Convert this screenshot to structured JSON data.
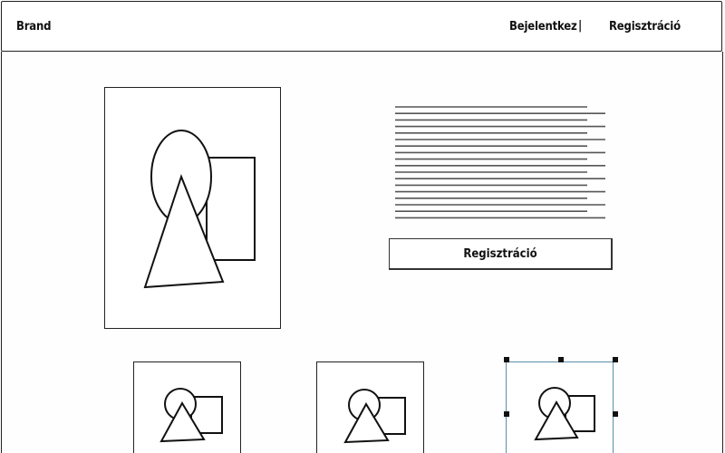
{
  "header": {
    "brand": "Brand",
    "nav": {
      "login_label": "Bejelentkez",
      "separator": "|",
      "register_label": "Regisztráció"
    }
  },
  "main": {
    "register_button_label": "Regisztráció",
    "text_placeholder_lines": 18
  },
  "thumbnails": {
    "count": 3,
    "selected_index": 2
  },
  "colors": {
    "border": "#222222",
    "selection": "#5a8fa8",
    "text_lines": "#555555"
  }
}
